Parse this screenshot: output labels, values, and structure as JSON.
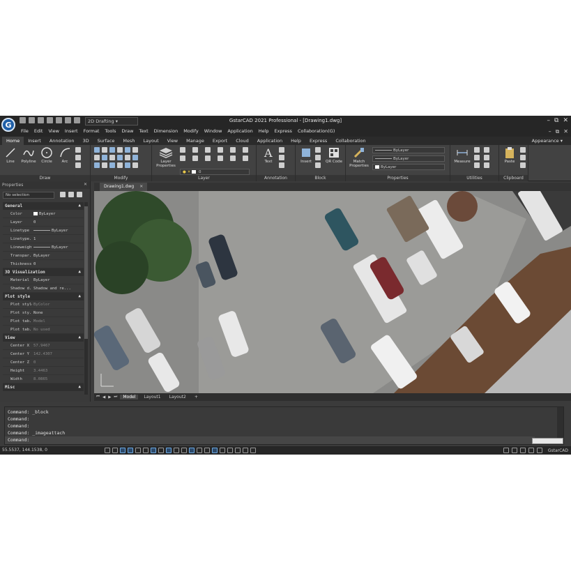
{
  "window": {
    "title": "GstarCAD 2021 Professional - [Drawing1.dwg]",
    "logo_letter": "G",
    "workspace": "2D Drafting",
    "controls": [
      "–",
      "⧉",
      "✕"
    ]
  },
  "menu": [
    "File",
    "Edit",
    "View",
    "Insert",
    "Format",
    "Tools",
    "Draw",
    "Text",
    "Dimension",
    "Modify",
    "Window",
    "Application",
    "Help",
    "Express",
    "Collaboration(G)"
  ],
  "ribbon_tabs": [
    "Home",
    "Insert",
    "Annotation",
    "3D",
    "Surface",
    "Mesh",
    "Layout",
    "View",
    "Manage",
    "Export",
    "Cloud",
    "Application",
    "Help",
    "Express",
    "Collaboration"
  ],
  "appearance_label": "Appearance",
  "ribbon": {
    "draw": {
      "title": "Draw",
      "tools": [
        "Line",
        "Polyline",
        "Circle",
        "Arc"
      ]
    },
    "modify": {
      "title": "Modify"
    },
    "layer": {
      "title": "Layer",
      "tool": "Layer Properties",
      "current_layer": "0"
    },
    "annotation": {
      "title": "Annotation",
      "tool": "Text"
    },
    "block": {
      "title": "Block",
      "tools": [
        "Insert",
        "QR Code"
      ]
    },
    "properties": {
      "title": "Properties",
      "tool": "Match Properties",
      "rows": [
        "ByLayer",
        "ByLayer",
        "ByLayer"
      ]
    },
    "utilities": {
      "title": "Utilities",
      "tool": "Measure"
    },
    "clipboard": {
      "title": "Clipboard",
      "tool": "Paste"
    }
  },
  "properties_panel": {
    "title": "Properties",
    "selection": "No selection",
    "sections": [
      {
        "name": "General",
        "rows": [
          {
            "key": "Color",
            "value": "ByLayer"
          },
          {
            "key": "Layer",
            "value": "0"
          },
          {
            "key": "Linetype",
            "value": "ByLayer"
          },
          {
            "key": "Linetype...",
            "value": "1"
          },
          {
            "key": "Lineweight",
            "value": "ByLayer"
          },
          {
            "key": "Transpar...",
            "value": "ByLayer"
          },
          {
            "key": "Thickness",
            "value": "0"
          }
        ]
      },
      {
        "name": "3D Visualization",
        "rows": [
          {
            "key": "Material",
            "value": "ByLayer"
          },
          {
            "key": "Shadow d...",
            "value": "Shadow and re..."
          }
        ]
      },
      {
        "name": "Plot style",
        "rows": [
          {
            "key": "Plot style",
            "value": "ByColor"
          },
          {
            "key": "Plot sty...",
            "value": "None"
          },
          {
            "key": "Plot tab...",
            "value": "Model"
          },
          {
            "key": "Plot tab...",
            "value": "No used"
          }
        ]
      },
      {
        "name": "View",
        "rows": [
          {
            "key": "Center X",
            "value": "57.9467"
          },
          {
            "key": "Center Y",
            "value": "142.4307"
          },
          {
            "key": "Center Z",
            "value": "0"
          },
          {
            "key": "Height",
            "value": "3.4463"
          },
          {
            "key": "Width",
            "value": "8.0865"
          }
        ]
      },
      {
        "name": "Misc",
        "rows": []
      }
    ]
  },
  "document_tab": "Drawing1.dwg",
  "layout_tabs": [
    "Model",
    "Layout1",
    "Layout2",
    "+"
  ],
  "command_history": [
    "Command: _block",
    "Command:",
    "Command:",
    "Command: _imageattach",
    "Command:"
  ],
  "status": {
    "coordinates": "55.5537, 144.1538, 0",
    "brand": "GstarCAD"
  },
  "colors": {
    "accent": "#1f5fa8",
    "ribbon_bg": "#424242",
    "titlebar_bg": "#262626"
  }
}
